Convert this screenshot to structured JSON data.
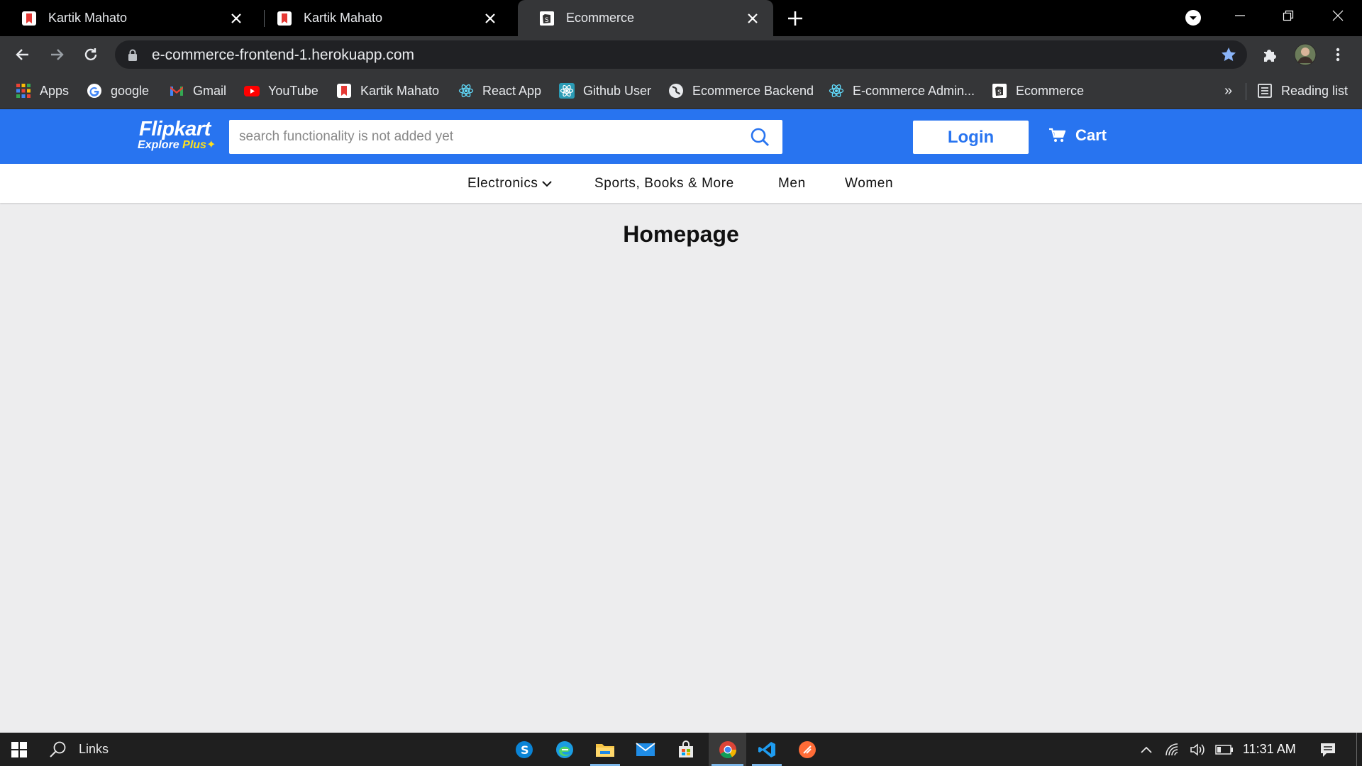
{
  "browser": {
    "tabs": [
      {
        "title": "Kartik Mahato"
      },
      {
        "title": "Kartik Mahato"
      },
      {
        "title": "Ecommerce"
      }
    ],
    "url": "e-commerce-frontend-1.herokuapp.com",
    "bookmarks": [
      {
        "label": "Apps"
      },
      {
        "label": "google"
      },
      {
        "label": "Gmail"
      },
      {
        "label": "YouTube"
      },
      {
        "label": "Kartik Mahato"
      },
      {
        "label": "React App"
      },
      {
        "label": "Github User"
      },
      {
        "label": "Ecommerce Backend"
      },
      {
        "label": "E-commerce Admin..."
      },
      {
        "label": "Ecommerce"
      }
    ],
    "more_bookmarks": "»",
    "reading_list": "Reading list"
  },
  "site": {
    "logo_main": "Flipkart",
    "logo_sub": "Explore",
    "logo_plus": "Plus",
    "search_placeholder": "search functionality is not added yet",
    "login_label": "Login",
    "cart_label": "Cart",
    "nav": [
      {
        "label": "Electronics"
      },
      {
        "label": "Sports, Books & More"
      },
      {
        "label": "Men"
      },
      {
        "label": "Women"
      }
    ],
    "page_title": "Homepage"
  },
  "taskbar": {
    "search_label": "Links",
    "time": "11:31 AM"
  },
  "colors": {
    "brand_blue": "#2874f0",
    "page_bg": "#ededee",
    "logo_plus_yellow": "#ffe11b"
  }
}
